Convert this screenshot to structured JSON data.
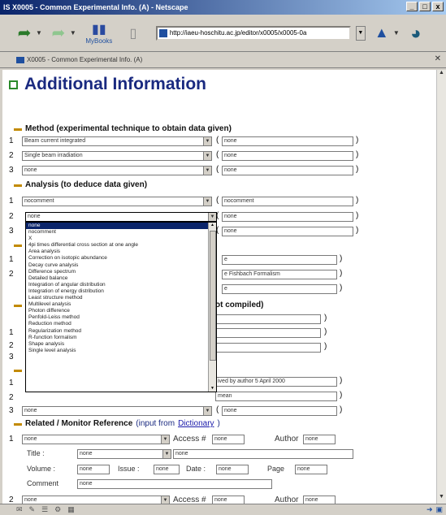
{
  "window": {
    "title": "IS X0005 - Common Experimental Info. (A) - Netscape",
    "controls": [
      "_",
      "□",
      "x"
    ]
  },
  "toolbar": {
    "url": "http://iaeu-hoschitu.ac.jp/editor/x0005/x0005-0a",
    "books_label": "MyBooks"
  },
  "tab": {
    "label": "X0005 - Common Experimental Info. (A)"
  },
  "page": {
    "title": "Additional Information",
    "method": {
      "heading": "Method (experimental technique to obtain data given)",
      "rows": [
        {
          "num": "1",
          "select": "Beam current integrated",
          "text": "none"
        },
        {
          "num": "2",
          "select": "Single beam irradiation",
          "text": "none"
        },
        {
          "num": "3",
          "select": "none",
          "text": "none"
        }
      ]
    },
    "analysis": {
      "heading": "Analysis (to deduce data given)",
      "rows": [
        {
          "num": "1",
          "select": "nocomment",
          "text": "nocomment"
        },
        {
          "num": "2",
          "select": "none",
          "text": "none"
        },
        {
          "num": "3",
          "select": "",
          "text": "none"
        }
      ]
    },
    "hidden_section": {
      "num1": "1",
      "num2": "2",
      "text1": "e",
      "text2": "e Fishbach Formalism",
      "text3": "e"
    },
    "not_compiled": {
      "heading_fragment": "ot compiled)",
      "num1": "1",
      "num2": "2",
      "num3": "3"
    },
    "row_misc": {
      "num1": "1",
      "num2": "2",
      "num3": "3",
      "text_a": "ived by author 5 April 2000",
      "text_b": "mean",
      "select3": "none",
      "text3": "none"
    },
    "related": {
      "heading": "Related / Monitor Reference",
      "input_from": "(input from ",
      "link": "Dictionary",
      "close": ")",
      "row1": {
        "num": "1",
        "select": "none",
        "access_label": "Access #",
        "access_value": "none",
        "author_label": "Author",
        "author_value": "none"
      },
      "title_label": "Title :",
      "title_select": "none",
      "title_value": "none",
      "volume_label": "Volume :",
      "volume_value": "none",
      "issue_label": "Issue :",
      "issue_value": "none",
      "date_label": "Date :",
      "date_value": "none",
      "page_label": "Page",
      "page_value": "none",
      "comment_label": "Comment",
      "comment_value": "none",
      "row2": {
        "num": "2",
        "select": "none",
        "access_label": "Access #",
        "access_value": "none",
        "author_label": "Author",
        "author_value": "none"
      }
    }
  },
  "dropdown": {
    "options": [
      "none",
      "nocomment",
      "X",
      "4pi times differential cross section at one angle",
      "Area analysis",
      "Correction on isotopic abundance",
      "Decay curve analysis",
      "Difference spectrum",
      "Detailed balance",
      "Integration of angular distribution",
      "Integration of energy distribution",
      "Least structure method",
      "Multilevel analysis",
      "Photon difference",
      "Penfold-Leiss method",
      "Reduction method",
      "Regularization method",
      "R-function formalism",
      "Shape analysis",
      "Single level analysis"
    ],
    "selected_index": 0
  },
  "colors": {
    "title": "#1a2a80",
    "accent": "#0a246a",
    "link": "#1a1aaa"
  }
}
